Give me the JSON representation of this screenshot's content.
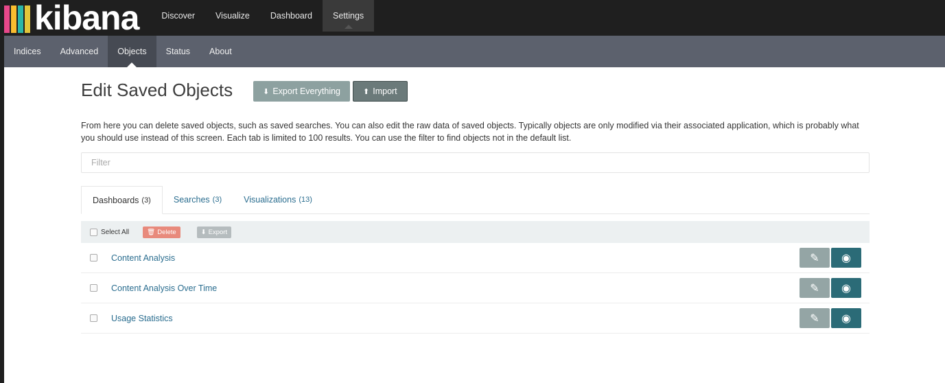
{
  "app": {
    "logo_text": "kibana",
    "logo_bar_colors": [
      "#e8488b",
      "#f9bd2f",
      "#2ab6a8",
      "#e2c53a"
    ]
  },
  "topnav": {
    "items": [
      {
        "label": "Discover"
      },
      {
        "label": "Visualize"
      },
      {
        "label": "Dashboard"
      },
      {
        "label": "Settings"
      }
    ],
    "active_index": 3
  },
  "subnav": {
    "items": [
      {
        "label": "Indices"
      },
      {
        "label": "Advanced"
      },
      {
        "label": "Objects"
      },
      {
        "label": "Status"
      },
      {
        "label": "About"
      }
    ],
    "active_index": 2
  },
  "page": {
    "title": "Edit Saved Objects",
    "export_everything_label": "Export Everything",
    "import_label": "Import",
    "description": "From here you can delete saved objects, such as saved searches. You can also edit the raw data of saved objects. Typically objects are only modified via their associated application, which is probably what you should use instead of this screen. Each tab is limited to 100 results. You can use the filter to find objects not in the default list.",
    "filter_placeholder": "Filter"
  },
  "tabs": [
    {
      "label": "Dashboards",
      "count": "(3)"
    },
    {
      "label": "Searches",
      "count": "(3)"
    },
    {
      "label": "Visualizations",
      "count": "(13)"
    }
  ],
  "toolbar": {
    "select_all_label": "Select All",
    "delete_label": "Delete",
    "export_label": "Export"
  },
  "objects": [
    {
      "name": "Content Analysis"
    },
    {
      "name": "Content Analysis Over Time"
    },
    {
      "name": "Usage Statistics"
    }
  ],
  "colors": {
    "topbar": "#1f1f1f",
    "subnav": "#5c616d",
    "link": "#2a6d8f",
    "view_button": "#2b6b77",
    "edit_button": "#94a5a5",
    "delete_button": "#e88a7c"
  }
}
